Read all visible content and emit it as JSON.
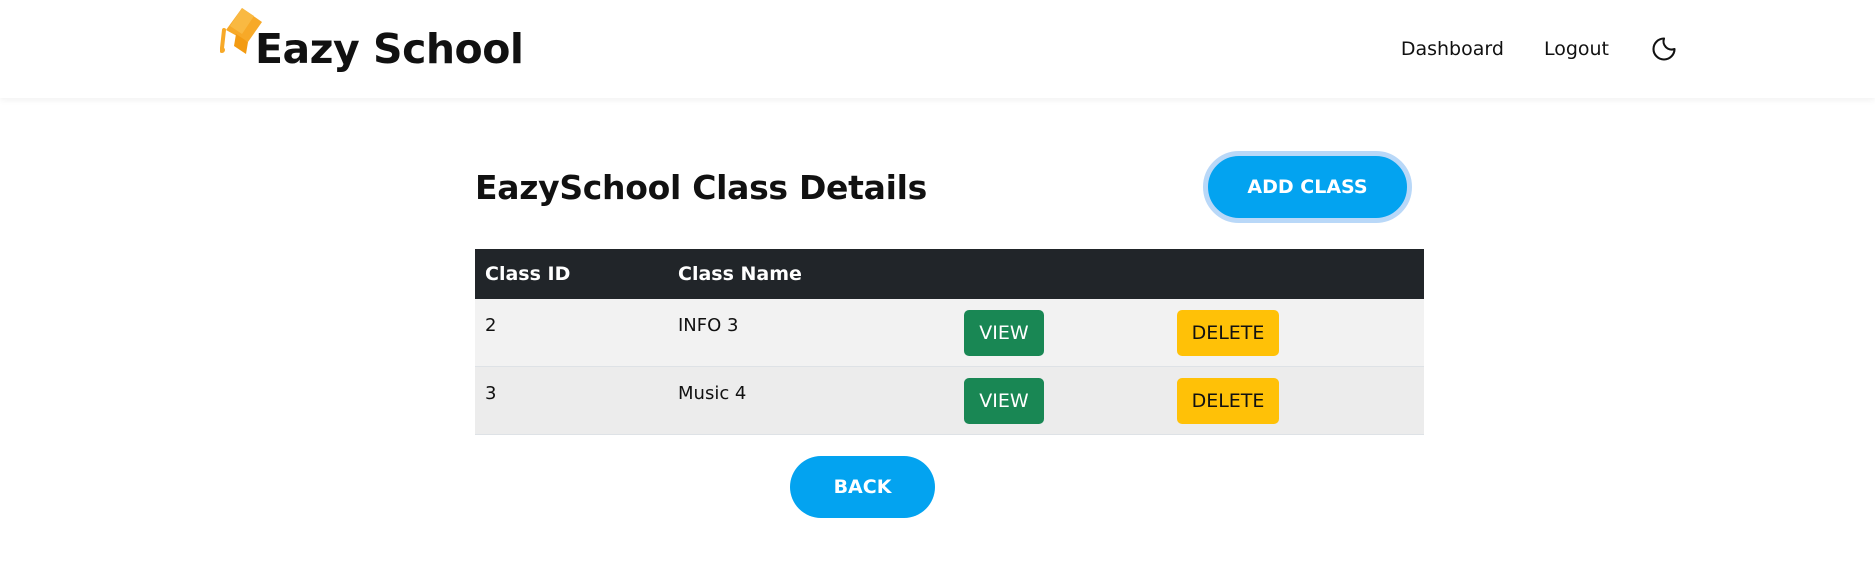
{
  "header": {
    "brand_name": "Eazy School",
    "brand_icon": "graduation-cap-icon",
    "nav": {
      "dashboard": "Dashboard",
      "logout": "Logout"
    },
    "theme_icon": "moon-icon"
  },
  "main": {
    "title": "EazySchool Class Details",
    "add_button": "ADD CLASS",
    "back_button": "BACK",
    "table": {
      "headers": [
        "Class ID",
        "Class Name",
        "",
        ""
      ],
      "rows": [
        {
          "id": "2",
          "name": "INFO 3",
          "view": "VIEW",
          "delete": "DELETE"
        },
        {
          "id": "3",
          "name": "Music 4",
          "view": "VIEW",
          "delete": "DELETE"
        }
      ]
    }
  },
  "colors": {
    "primary": "#03a3f0",
    "view_button": "#198754",
    "delete_button": "#ffc107",
    "table_header": "#212529",
    "brand_icon": "#f7a928"
  }
}
